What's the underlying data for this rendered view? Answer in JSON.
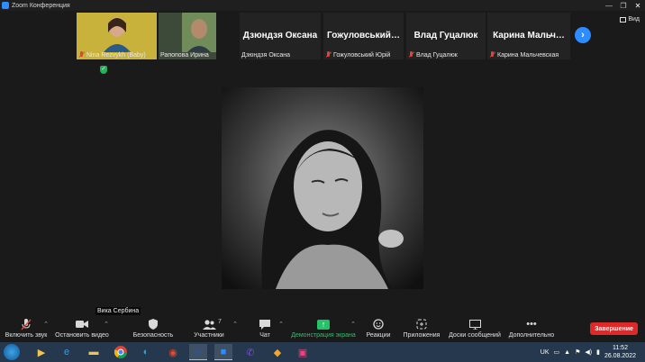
{
  "window": {
    "title": "Zoom Конференция",
    "controls": [
      "—",
      "❐",
      "✕"
    ]
  },
  "strip": {
    "tiles": [
      {
        "name": "Nina Rezvykh (Baby)",
        "muted": true,
        "type": "video",
        "color": "#c9b23c"
      },
      {
        "name": "Рапопова Ирина",
        "muted": false,
        "type": "video",
        "color": "#6f8c5a"
      },
      {
        "big_name": "Дзюндзя Оксана",
        "name": "Дзюндзя Оксана",
        "muted": false,
        "type": "name"
      },
      {
        "big_name": "Гожуловський…",
        "name": "Гожуловський Юрій",
        "muted": true,
        "type": "name"
      },
      {
        "big_name": "Влад Гуцалюк",
        "name": "Влад Гуцалюк",
        "muted": true,
        "type": "name"
      },
      {
        "big_name": "Карина Мальч…",
        "name": "Карина Мальчевская",
        "muted": true,
        "type": "name"
      }
    ],
    "next_icon": "chevron-right-icon",
    "view_label": "Вид"
  },
  "main": {
    "speaker_name": "Вика Сербина"
  },
  "toolbar": {
    "mic_label": "Включить звук",
    "video_label": "Остановить видео",
    "security_label": "Безопасность",
    "participants_label": "Участники",
    "participants_count": "7",
    "chat_label": "Чат",
    "share_label": "Демонстрация экрана",
    "reactions_label": "Реакции",
    "apps_label": "Приложения",
    "whiteboard_label": "Доски сообщений",
    "more_label": "Дополнительно",
    "end_label": "Завершение"
  },
  "taskbar": {
    "lang": "UK",
    "time": "11:52",
    "date": "26.08.2022"
  },
  "colors": {
    "accent": "#2d8cff",
    "share_green": "#24c368",
    "end_red": "#e02828",
    "muted_red": "#e0453a"
  }
}
